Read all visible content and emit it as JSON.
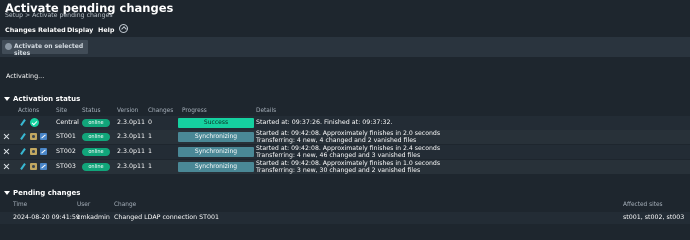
{
  "header": {
    "title": "Activate pending changes",
    "breadcrumb": "Setup > Activate pending changes"
  },
  "menu": {
    "items": [
      "Changes",
      "Related",
      "Display",
      "Help"
    ]
  },
  "toolbar": {
    "activate_selected_label": "Activate on selected sites"
  },
  "status_message": "Activating...",
  "activation_status": {
    "section_title": "Activation status",
    "columns": [
      "Actions",
      "Site",
      "Status",
      "Version",
      "Changes",
      "Progress",
      "Details"
    ],
    "rows": [
      {
        "site": "Central",
        "status": "online",
        "version": "2.3.0p11",
        "changes": "0",
        "progress": "Success",
        "details_line1": "Started at: 09:37:26. Finished at: 09:37:32.",
        "details_line2": ""
      },
      {
        "site": "ST001",
        "status": "online",
        "version": "2.3.0p11",
        "changes": "1",
        "progress": "Synchronizing",
        "details_line1": "Started at: 09:42:08. Approximately finishes in 2.0 seconds",
        "details_line2": "Transferring: 4 new, 4 changed and 2 vanished files"
      },
      {
        "site": "ST002",
        "status": "online",
        "version": "2.3.0p11",
        "changes": "1",
        "progress": "Synchronizing",
        "details_line1": "Started at: 09:42:08. Approximately finishes in 2.4 seconds",
        "details_line2": "Transferring: 4 new, 46 changed and 3 vanished files"
      },
      {
        "site": "ST003",
        "status": "online",
        "version": "2.3.0p11",
        "changes": "1",
        "progress": "Synchronizing",
        "details_line1": "Started at: 09:42:08. Approximately finishes in 1.0 seconds",
        "details_line2": "Transferring: 3 new, 30 changed and 2 vanished files"
      }
    ]
  },
  "pending_changes": {
    "section_title": "Pending changes",
    "columns": [
      "Time",
      "User",
      "Change",
      "Affected sites"
    ],
    "rows": [
      {
        "time": "2024-08-20 09:41:59",
        "user": "cmkadmin",
        "change": "Changed LDAP connection ST001",
        "affected_sites": "st001, st002, st003"
      }
    ]
  },
  "icons": {
    "collapse": "chevron-up-icon",
    "activate": "activate-icon",
    "remove": "close-icon",
    "edit": "edit-icon",
    "snapshot": "image-icon",
    "site_action": "site-action-icon",
    "ok": "check-circle-icon"
  },
  "colors": {
    "background": "#1e262e",
    "success": "#15d1a0",
    "synchronizing": "#4a8896",
    "online": "#11a57a"
  }
}
